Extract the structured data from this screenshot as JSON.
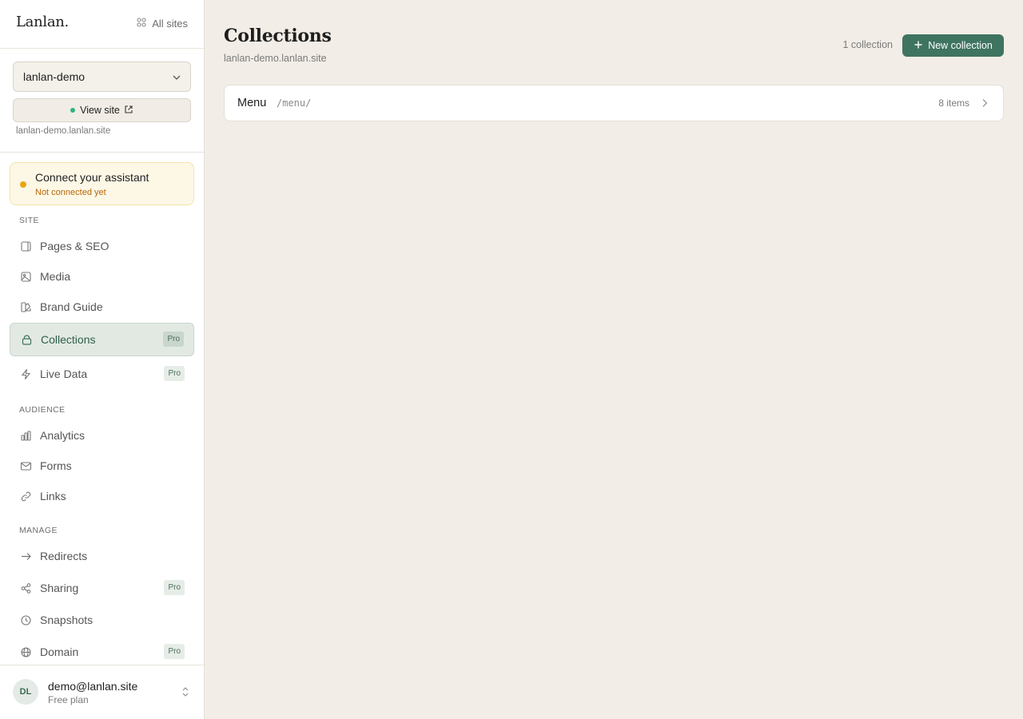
{
  "brand": {
    "logo": "Lanlan."
  },
  "header": {
    "all_sites_label": "All sites"
  },
  "site": {
    "selected": "lanlan-demo",
    "view_site_label": "View site",
    "url": "lanlan-demo.lanlan.site"
  },
  "assistant": {
    "title": "Connect your assistant",
    "status": "Not connected yet"
  },
  "sidebar": {
    "sections": {
      "site": "SITE",
      "audience": "AUDIENCE",
      "manage": "MANAGE"
    },
    "items": [
      {
        "label": "Pages & SEO",
        "icon": "page-icon"
      },
      {
        "label": "Media",
        "icon": "image-icon"
      },
      {
        "label": "Brand Guide",
        "icon": "palette-icon"
      },
      {
        "label": "Collections",
        "icon": "collection-icon",
        "badge": "Pro",
        "active": true
      },
      {
        "label": "Live Data",
        "icon": "bolt-icon",
        "badge": "Pro"
      },
      {
        "label": "Analytics",
        "icon": "bar-chart-icon"
      },
      {
        "label": "Forms",
        "icon": "mail-icon"
      },
      {
        "label": "Links",
        "icon": "link-icon"
      },
      {
        "label": "Redirects",
        "icon": "arrow-right-icon"
      },
      {
        "label": "Sharing",
        "icon": "share-icon",
        "badge": "Pro"
      },
      {
        "label": "Snapshots",
        "icon": "clock-icon"
      },
      {
        "label": "Domain",
        "icon": "globe-icon",
        "badge": "Pro"
      }
    ]
  },
  "user": {
    "initials": "DL",
    "email": "demo@lanlan.site",
    "plan": "Free plan"
  },
  "main": {
    "title": "Collections",
    "subtitle": "lanlan-demo.lanlan.site",
    "count": "1 collection",
    "new_button": "New collection",
    "collections": [
      {
        "name": "Menu",
        "path": "/menu/",
        "items": "8 items"
      }
    ]
  },
  "colors": {
    "accent": "#3f7461",
    "background": "#f2ede6",
    "warning_dot": "#e9a613",
    "live_dot": "#2fb37a"
  }
}
